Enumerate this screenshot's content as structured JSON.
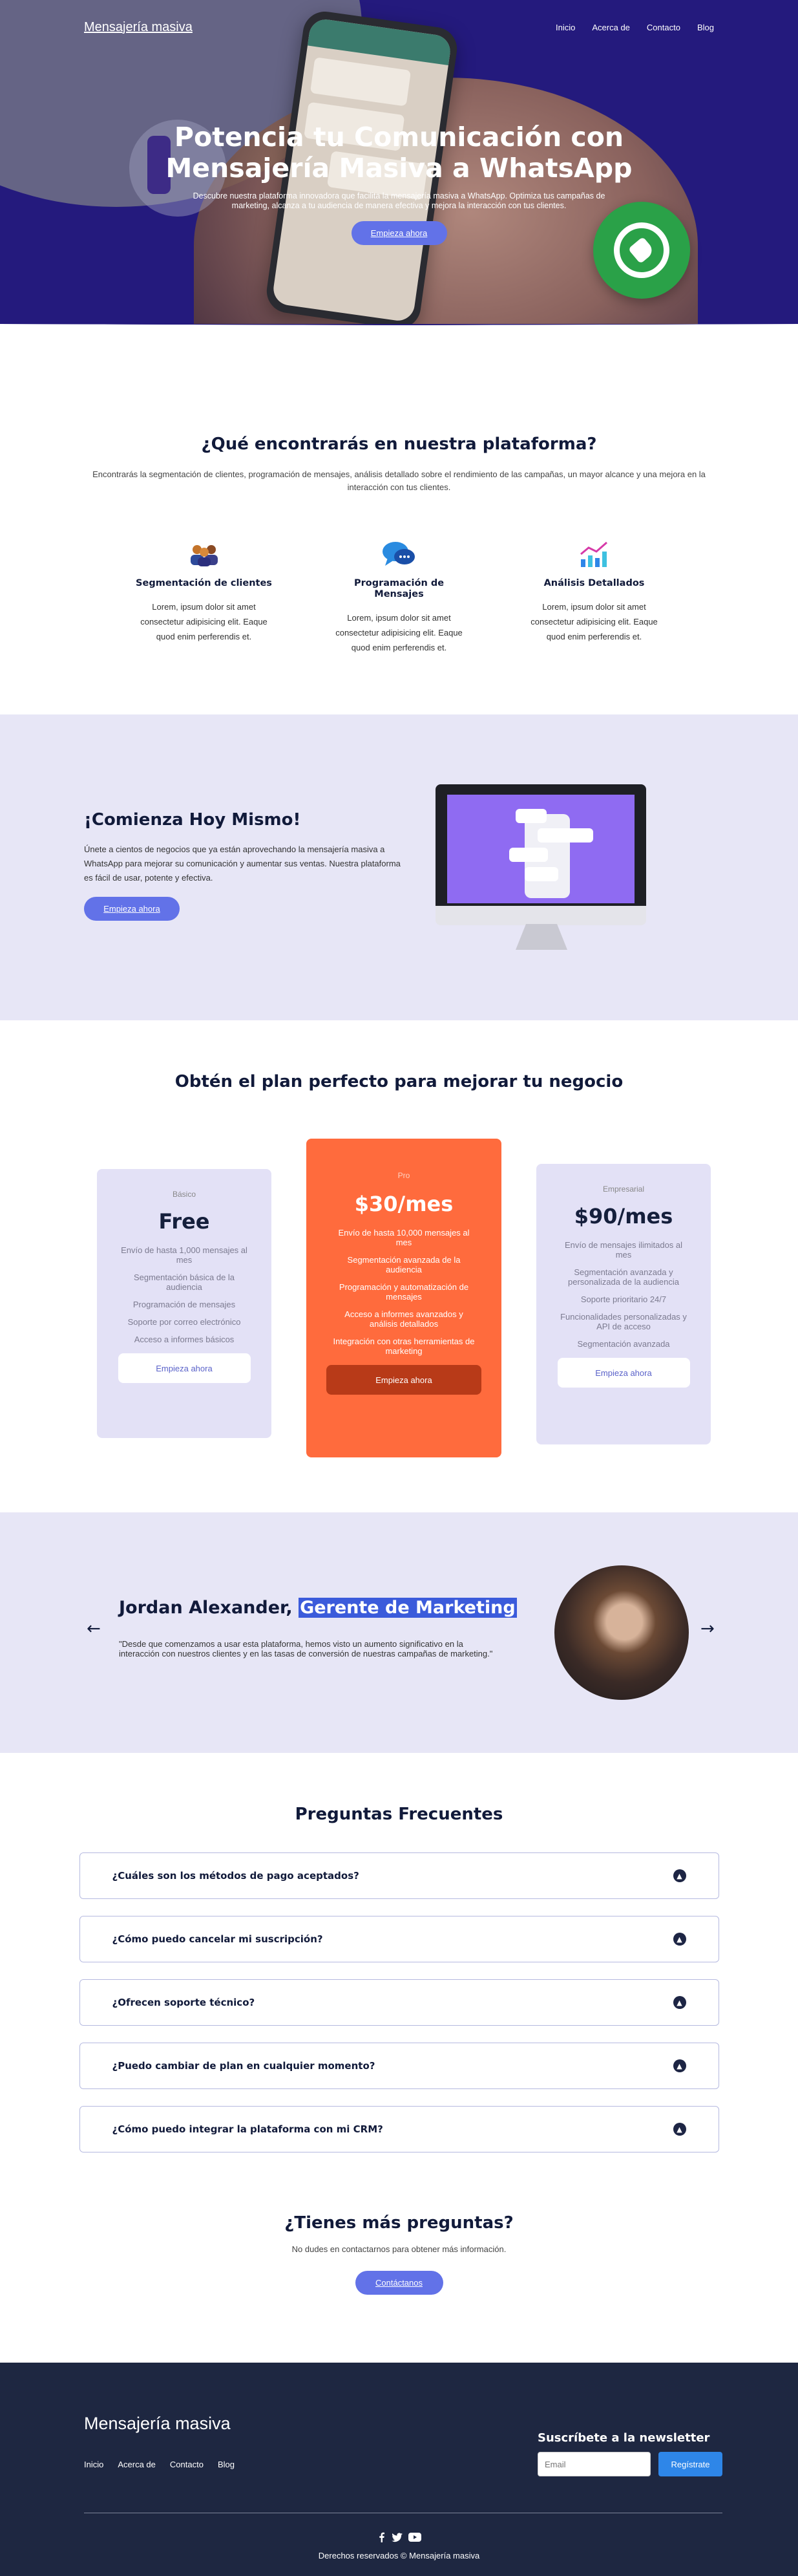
{
  "nav": {
    "brand": "Mensajería masiva",
    "links": [
      "Inicio",
      "Acerca de",
      "Contacto",
      "Blog"
    ]
  },
  "hero": {
    "title_line1": "Potencia tu Comunicación con",
    "title_line2": "Mensajería Masiva a WhatsApp",
    "subtitle": "Descubre nuestra plataforma innovadora que facilita la mensajería masiva a WhatsApp. Optimiza tus campañas de marketing, alcanza a tu audiencia de manera efectiva y mejora la interacción con tus clientes.",
    "cta": "Empieza ahora"
  },
  "features": {
    "title": "¿Qué encontrarás en nuestra plataforma?",
    "description": "Encontrarás la segmentación de clientes, programación de mensajes, análisis detallado sobre el rendimiento de las campañas, un mayor alcance y una mejora en la interacción con tus clientes.",
    "items": [
      {
        "icon": "people-icon",
        "title": "Segmentación de clientes",
        "text": "Lorem, ipsum dolor sit amet consectetur adipisicing elit. Eaque quod enim perferendis et."
      },
      {
        "icon": "chat-bubbles-icon",
        "title": "Programación de Mensajes",
        "text": "Lorem, ipsum dolor sit amet consectetur adipisicing elit. Eaque quod enim perferendis et."
      },
      {
        "icon": "analytics-chart-icon",
        "title": "Análisis Detallados",
        "text": "Lorem, ipsum dolor sit amet consectetur adipisicing elit. Eaque quod enim perferendis et."
      }
    ]
  },
  "cta": {
    "title": "¡Comienza Hoy Mismo!",
    "text": "Únete a cientos de negocios que ya están aprovechando la mensajería masiva a WhatsApp para mejorar su comunicación y aumentar sus ventas. Nuestra plataforma es fácil de usar, potente y efectiva.",
    "button": "Empieza ahora"
  },
  "pricing": {
    "title": "Obtén el plan perfecto para mejorar tu negocio",
    "plans": [
      {
        "name": "Básico",
        "price": "Free",
        "features": [
          "Envío de hasta 1,000 mensajes al mes",
          "Segmentación básica de la audiencia",
          "Programación de mensajes",
          "Soporte por correo electrónico",
          "Acceso a informes básicos"
        ],
        "button": "Empieza ahora"
      },
      {
        "name": "Pro",
        "price": "$30/mes",
        "features": [
          "Envío de hasta 10,000 mensajes al mes",
          "Segmentación avanzada de la audiencia",
          "Programación y automatización de mensajes",
          "Acceso a informes avanzados y análisis detallados",
          "Integración con otras herramientas de marketing"
        ],
        "button": "Empieza ahora"
      },
      {
        "name": "Empresarial",
        "price": "$90/mes",
        "features": [
          "Envío de mensajes ilimitados al mes",
          "Segmentación avanzada y personalizada de la audiencia",
          "Soporte prioritario 24/7",
          "Funcionalidades personalizadas y API de acceso",
          "Segmentación avanzada"
        ],
        "button": "Empieza ahora"
      }
    ]
  },
  "testimonial": {
    "name": "Jordan Alexander,",
    "role": "Gerente de Marketing",
    "quote": "\"Desde que comenzamos a usar esta plataforma, hemos visto un aumento significativo en la interacción con nuestros clientes y en las tasas de conversión de nuestras campañas de marketing.\""
  },
  "faq": {
    "title": "Preguntas Frecuentes",
    "items": [
      "¿Cuáles son los métodos de pago aceptados?",
      "¿Cómo puedo cancelar mi suscripción?",
      "¿Ofrecen soporte técnico?",
      "¿Puedo cambiar de plan en cualquier momento?",
      "¿Cómo puedo integrar la plataforma con mi CRM?"
    ]
  },
  "more": {
    "title": "¿Tienes más preguntas?",
    "text": "No dudes en contactarnos para obtener más información.",
    "button": "Contáctanos"
  },
  "footer": {
    "brand": "Mensajería masiva",
    "links": [
      "Inicio",
      "Acerca de",
      "Contacto",
      "Blog"
    ],
    "newsletter_title": "Suscríbete a la newsletter",
    "email_placeholder": "Email",
    "subscribe": "Regístrate",
    "social": [
      "facebook-icon",
      "twitter-icon",
      "youtube-icon"
    ],
    "copyright": "Derechos reservados © Mensajería masiva"
  },
  "colors": {
    "hero_bg": "#241a7d",
    "accent": "#6272e8",
    "pro_plan": "#ff6b3d",
    "section_bg": "#e7e6f6",
    "footer_bg": "#1e2741"
  }
}
